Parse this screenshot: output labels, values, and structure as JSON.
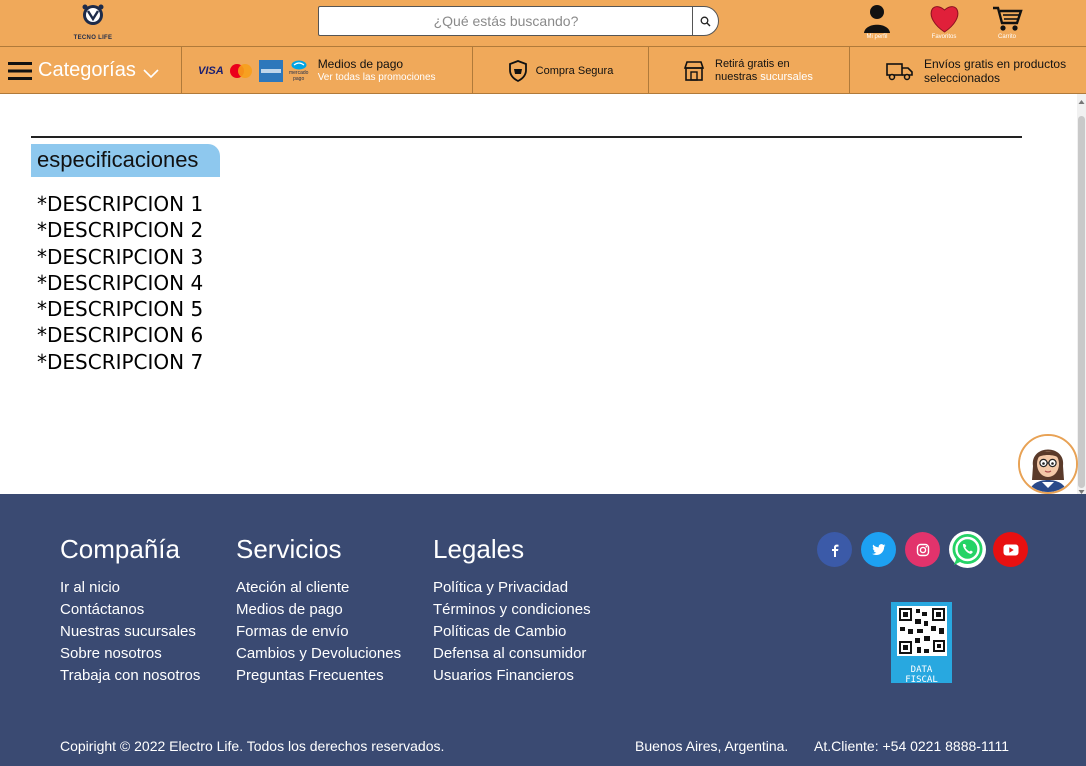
{
  "header": {
    "logo_text": "TECNO LIFE",
    "search_placeholder": "¿Qué estás buscando?",
    "profile_label": "Mi perfil",
    "favorites_label": "Favoritos",
    "cart_label": "Carrito"
  },
  "nav": {
    "categories_label": "Categorías",
    "payment_logos": [
      "VISA",
      "mercado pago"
    ],
    "payment_title": "Medios de pago",
    "payment_sub": "Ver todas las promociones",
    "secure_label": "Compra Segura",
    "pickup_line1": "Retirá gratis en",
    "pickup_line2_a": "nuestras ",
    "pickup_line2_b": "sucursales",
    "shipping_line1": "Envíos gratis en productos",
    "shipping_line2": "seleccionados"
  },
  "main": {
    "spec_title": "especificaciones",
    "descriptions": [
      "*DESCRIPCION 1",
      "*DESCRIPCION 2",
      "*DESCRIPCION 3",
      "*DESCRIPCION 4",
      "*DESCRIPCION 5",
      "*DESCRIPCION 6",
      "*DESCRIPCION 7"
    ]
  },
  "footer": {
    "company": {
      "title": "Compañía",
      "links": [
        "Ir al nicio",
        "Contáctanos",
        "Nuestras sucursales",
        "Sobre nosotros",
        "Trabaja con nosotros"
      ]
    },
    "services": {
      "title": "Servicios",
      "links": [
        "Ateción al cliente",
        "Medios de pago",
        "Formas de envío",
        "Cambios y Devoluciones",
        "Preguntas Frecuentes"
      ]
    },
    "legal": {
      "title": "Legales",
      "links": [
        "Política y Privacidad",
        "Términos y condiciones",
        "Políticas de Cambio",
        "Defensa al consumidor",
        "Usuarios Financieros"
      ]
    },
    "qr_label_1": "DATA",
    "qr_label_2": "FISCAL",
    "copyright": "Copiright © 2022 Electro Life.  Todos los derechos reservados.",
    "location": "Buenos Aires, Argentina.",
    "phone": "At.Cliente: +54 0221 8888-1111"
  },
  "colors": {
    "header_bg": "#f0a95a",
    "spec_tab": "#8ec8ee",
    "footer_bg": "#3a4a72",
    "facebook": "#3b5aa8",
    "twitter": "#1da1f2",
    "instagram": "#e2336c",
    "whatsapp": "#25d366",
    "youtube": "#e81010"
  },
  "icons": [
    "logo-icon",
    "search-icon",
    "user-icon",
    "heart-icon",
    "cart-icon",
    "menu-icon",
    "chevron-down-icon",
    "shield-icon",
    "store-icon",
    "truck-icon",
    "facebook-icon",
    "twitter-icon",
    "instagram-icon",
    "whatsapp-icon",
    "youtube-icon"
  ]
}
